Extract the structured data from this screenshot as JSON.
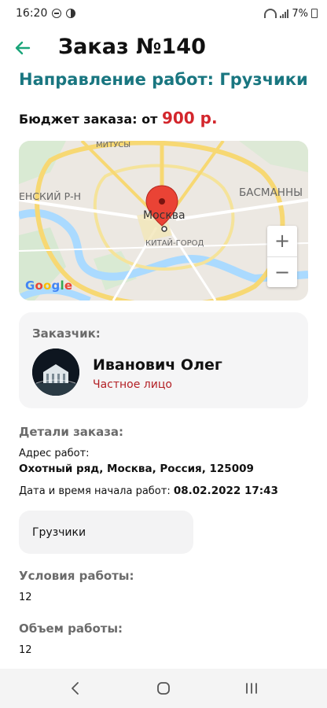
{
  "status_bar": {
    "time": "16:20",
    "battery": "7%",
    "icons": [
      "do-not-disturb-icon",
      "app-notification-icon",
      "wifi-icon",
      "signal-icon",
      "battery-icon"
    ]
  },
  "header": {
    "title": "Заказ №140",
    "back_icon": "arrow-left-icon",
    "accent_color": "#1aa57a"
  },
  "direction": "Направление работ: Грузчики",
  "budget": {
    "label": "Бюджет заказа: от",
    "amount": "900 р.",
    "amount_color": "#d3262c"
  },
  "map": {
    "labels": {
      "mitusy": "МИТУСЫ",
      "district": "ЕНСКИЙ Р-Н",
      "basmanny": "БАСМАННЫ",
      "moskva": "Москва",
      "kitay": "КИТАЙ-ГОРОД"
    },
    "zoom_in": "+",
    "zoom_out": "−",
    "logo": "Google"
  },
  "customer": {
    "label": "Заказчик:",
    "name": "Иванович Олег",
    "type": "Частное лицо"
  },
  "details": {
    "title": "Детали заказа:",
    "address_label": "Адрес работ:",
    "address_value": "Охотный ряд, Москва, Россия, 125009",
    "datetime_label": "Дата и время начала работ:",
    "datetime_value": "08.02.2022 17:43",
    "category": "Грузчики"
  },
  "conditions": {
    "title": "Условия работы:",
    "value": "12"
  },
  "volume": {
    "title": "Объем работы:",
    "value": "12"
  },
  "navbar": {
    "icons": [
      "back-icon",
      "home-icon",
      "recents-icon"
    ]
  }
}
